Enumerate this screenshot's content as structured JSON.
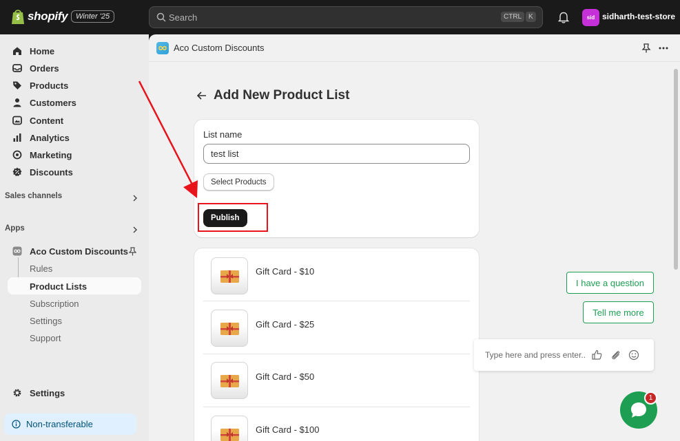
{
  "topbar": {
    "brand": "shopify",
    "edition": "Winter '25",
    "search_placeholder": "Search",
    "shortcut_ctrl": "CTRL",
    "shortcut_key": "K",
    "avatar_initials": "sid",
    "store_name": "sidharth-test-store"
  },
  "sidebar": {
    "items": [
      {
        "label": "Home",
        "icon": "home-icon"
      },
      {
        "label": "Orders",
        "icon": "inbox-icon"
      },
      {
        "label": "Products",
        "icon": "tag-icon"
      },
      {
        "label": "Customers",
        "icon": "person-icon"
      },
      {
        "label": "Content",
        "icon": "content-icon"
      },
      {
        "label": "Analytics",
        "icon": "chart-icon"
      },
      {
        "label": "Marketing",
        "icon": "target-icon"
      },
      {
        "label": "Discounts",
        "icon": "discount-icon"
      }
    ],
    "sales_channels": "Sales channels",
    "apps": "Apps",
    "app_name": "Aco Custom Discounts",
    "app_subitems": [
      "Rules",
      "Product Lists",
      "Subscription",
      "Settings",
      "Support"
    ],
    "settings": "Settings",
    "non_transferable": "Non-transferable"
  },
  "app": {
    "header_title": "Aco Custom Discounts",
    "page_title": "Add New Product List",
    "list_name_label": "List name",
    "list_name_value": "test list",
    "select_products_label": "Select Products",
    "publish_label": "Publish",
    "products": [
      {
        "name": "Gift Card - $10"
      },
      {
        "name": "Gift Card - $25"
      },
      {
        "name": "Gift Card - $50"
      },
      {
        "name": "Gift Card - $100"
      }
    ]
  },
  "chat": {
    "question_label": "I have a question",
    "tell_more_label": "Tell me more",
    "input_placeholder": "Type here and press enter..",
    "badge_count": "1",
    "accent": "#1e9e52"
  },
  "colors": {
    "annotation": "#e8141b",
    "topbar": "#1a1a1a",
    "sidebar": "#ebebeb"
  }
}
